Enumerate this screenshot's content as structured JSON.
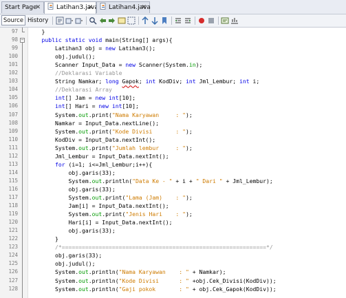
{
  "tabs": [
    {
      "label": "Start Page",
      "icon": "none"
    },
    {
      "label": "Latihan3.java",
      "icon": "java-file-icon"
    },
    {
      "label": "Latihan4.java",
      "icon": "java-file-icon"
    }
  ],
  "toolbar": {
    "source_label": "Source",
    "history_label": "History"
  },
  "editor": {
    "lines": [
      {
        "num": "97",
        "segs": [
          {
            "t": "    }",
            "c": ""
          }
        ]
      },
      {
        "num": "98",
        "segs": [
          {
            "t": "    ",
            "c": ""
          },
          {
            "t": "public static void",
            "c": "kw"
          },
          {
            "t": " main(String[] args){",
            "c": ""
          }
        ]
      },
      {
        "num": "99",
        "segs": [
          {
            "t": "        Latihan3 obj = ",
            "c": ""
          },
          {
            "t": "new",
            "c": "kw"
          },
          {
            "t": " Latihan3();",
            "c": ""
          }
        ]
      },
      {
        "num": "100",
        "segs": [
          {
            "t": "        obj.judul();",
            "c": ""
          }
        ]
      },
      {
        "num": "101",
        "segs": [
          {
            "t": "        Scanner Input_Data = ",
            "c": ""
          },
          {
            "t": "new",
            "c": "kw"
          },
          {
            "t": " Scanner(System.",
            "c": ""
          },
          {
            "t": "in",
            "c": "fld"
          },
          {
            "t": ");",
            "c": ""
          }
        ]
      },
      {
        "num": "102",
        "segs": [
          {
            "t": "        //Deklarasi Variable",
            "c": "cmt"
          }
        ]
      },
      {
        "num": "103",
        "segs": [
          {
            "t": "        String Namkar; ",
            "c": ""
          },
          {
            "t": "long",
            "c": "kw"
          },
          {
            "t": " ",
            "c": ""
          },
          {
            "t": "Gapok",
            "c": "err"
          },
          {
            "t": "; ",
            "c": ""
          },
          {
            "t": "int",
            "c": "kw"
          },
          {
            "t": " KodDiv; ",
            "c": ""
          },
          {
            "t": "int",
            "c": "kw"
          },
          {
            "t": " Jml_Lembur; ",
            "c": ""
          },
          {
            "t": "int",
            "c": "kw"
          },
          {
            "t": " i;",
            "c": ""
          }
        ]
      },
      {
        "num": "104",
        "segs": [
          {
            "t": "        //Deklarasi Array",
            "c": "cmt"
          }
        ]
      },
      {
        "num": "105",
        "segs": [
          {
            "t": "        ",
            "c": ""
          },
          {
            "t": "int",
            "c": "kw"
          },
          {
            "t": "[] Jam = ",
            "c": ""
          },
          {
            "t": "new",
            "c": "kw"
          },
          {
            "t": " ",
            "c": ""
          },
          {
            "t": "int",
            "c": "kw"
          },
          {
            "t": "[10];",
            "c": ""
          }
        ]
      },
      {
        "num": "106",
        "segs": [
          {
            "t": "        ",
            "c": ""
          },
          {
            "t": "int",
            "c": "kw"
          },
          {
            "t": "[] Hari = ",
            "c": ""
          },
          {
            "t": "new",
            "c": "kw"
          },
          {
            "t": " ",
            "c": ""
          },
          {
            "t": "int",
            "c": "kw"
          },
          {
            "t": "[10];",
            "c": ""
          }
        ]
      },
      {
        "num": "107",
        "segs": [
          {
            "t": "        System.",
            "c": ""
          },
          {
            "t": "out",
            "c": "fld"
          },
          {
            "t": ".print(",
            "c": ""
          },
          {
            "t": "\"Nama Karyawan     : \"",
            "c": "str"
          },
          {
            "t": ");",
            "c": ""
          }
        ]
      },
      {
        "num": "108",
        "segs": [
          {
            "t": "        Namkar = Input_Data.nextLine();",
            "c": ""
          }
        ]
      },
      {
        "num": "109",
        "segs": [
          {
            "t": "        System.",
            "c": ""
          },
          {
            "t": "out",
            "c": "fld"
          },
          {
            "t": ".print(",
            "c": ""
          },
          {
            "t": "\"Kode Divisi       : \"",
            "c": "str"
          },
          {
            "t": ");",
            "c": ""
          }
        ]
      },
      {
        "num": "110",
        "segs": [
          {
            "t": "        KodDiv = Input_Data.nextInt();",
            "c": ""
          }
        ]
      },
      {
        "num": "111",
        "segs": [
          {
            "t": "        System.",
            "c": ""
          },
          {
            "t": "out",
            "c": "fld"
          },
          {
            "t": ".print(",
            "c": ""
          },
          {
            "t": "\"Jumlah lembur     : \"",
            "c": "str"
          },
          {
            "t": ");",
            "c": ""
          }
        ]
      },
      {
        "num": "112",
        "segs": [
          {
            "t": "        Jml_Lembur = Input_Data.nextInt();",
            "c": ""
          }
        ]
      },
      {
        "num": "113",
        "segs": [
          {
            "t": "        ",
            "c": ""
          },
          {
            "t": "for",
            "c": "kw"
          },
          {
            "t": " (i=1; i<=Jml_Lembur;i++){",
            "c": ""
          }
        ]
      },
      {
        "num": "114",
        "segs": [
          {
            "t": "            obj.garis(33);",
            "c": ""
          }
        ]
      },
      {
        "num": "115",
        "segs": [
          {
            "t": "            System.",
            "c": ""
          },
          {
            "t": "out",
            "c": "fld"
          },
          {
            "t": ".println(",
            "c": ""
          },
          {
            "t": "\"Data Ke - \"",
            "c": "str"
          },
          {
            "t": " + i + ",
            "c": ""
          },
          {
            "t": "\" Dari \"",
            "c": "str"
          },
          {
            "t": " + Jml_Lembur);",
            "c": ""
          }
        ]
      },
      {
        "num": "116",
        "segs": [
          {
            "t": "            obj.garis(33);",
            "c": ""
          }
        ]
      },
      {
        "num": "117",
        "segs": [
          {
            "t": "            System.",
            "c": ""
          },
          {
            "t": "out",
            "c": "fld"
          },
          {
            "t": ".print(",
            "c": ""
          },
          {
            "t": "\"Lama (Jam)    : \"",
            "c": "str"
          },
          {
            "t": ");",
            "c": ""
          }
        ]
      },
      {
        "num": "118",
        "segs": [
          {
            "t": "            Jam[i] = Input_Data.nextInt();",
            "c": ""
          }
        ]
      },
      {
        "num": "119",
        "segs": [
          {
            "t": "            System.",
            "c": ""
          },
          {
            "t": "out",
            "c": "fld"
          },
          {
            "t": ".print(",
            "c": ""
          },
          {
            "t": "\"Jenis Hari    : \"",
            "c": "str"
          },
          {
            "t": ");",
            "c": ""
          }
        ]
      },
      {
        "num": "120",
        "segs": [
          {
            "t": "            Hari[i] = Input_Data.nextInt();",
            "c": ""
          }
        ]
      },
      {
        "num": "121",
        "segs": [
          {
            "t": "            obj.garis(33);",
            "c": ""
          }
        ]
      },
      {
        "num": "122",
        "segs": [
          {
            "t": "        }",
            "c": ""
          }
        ]
      },
      {
        "num": "123",
        "segs": [
          {
            "t": "        /*=============================================================*/",
            "c": "cmt"
          }
        ]
      },
      {
        "num": "124",
        "segs": [
          {
            "t": "        obj.garis(33);",
            "c": ""
          }
        ]
      },
      {
        "num": "125",
        "segs": [
          {
            "t": "        obj.judul();",
            "c": ""
          }
        ]
      },
      {
        "num": "126",
        "segs": [
          {
            "t": "        System.",
            "c": ""
          },
          {
            "t": "out",
            "c": "fld"
          },
          {
            "t": ".println(",
            "c": ""
          },
          {
            "t": "\"Nama Karyawan    : \"",
            "c": "str"
          },
          {
            "t": " + Namkar);",
            "c": ""
          }
        ]
      },
      {
        "num": "127",
        "segs": [
          {
            "t": "        System.",
            "c": ""
          },
          {
            "t": "out",
            "c": "fld"
          },
          {
            "t": ".println(",
            "c": ""
          },
          {
            "t": "\"Kode Divisi      : \"",
            "c": "str"
          },
          {
            "t": " +obj.Cek_Divisi(KodDiv));",
            "c": ""
          }
        ]
      },
      {
        "num": "128",
        "segs": [
          {
            "t": "        System.",
            "c": ""
          },
          {
            "t": "out",
            "c": "fld"
          },
          {
            "t": ".println(",
            "c": ""
          },
          {
            "t": "\"Gaji pokok       : \"",
            "c": "str"
          },
          {
            "t": " + obj.Cek_Gapok(KodDiv));",
            "c": ""
          }
        ]
      }
    ]
  },
  "colors": {
    "keyword": "#0000e6",
    "string": "#ce7b00",
    "comment": "#969696",
    "field": "#009900"
  }
}
